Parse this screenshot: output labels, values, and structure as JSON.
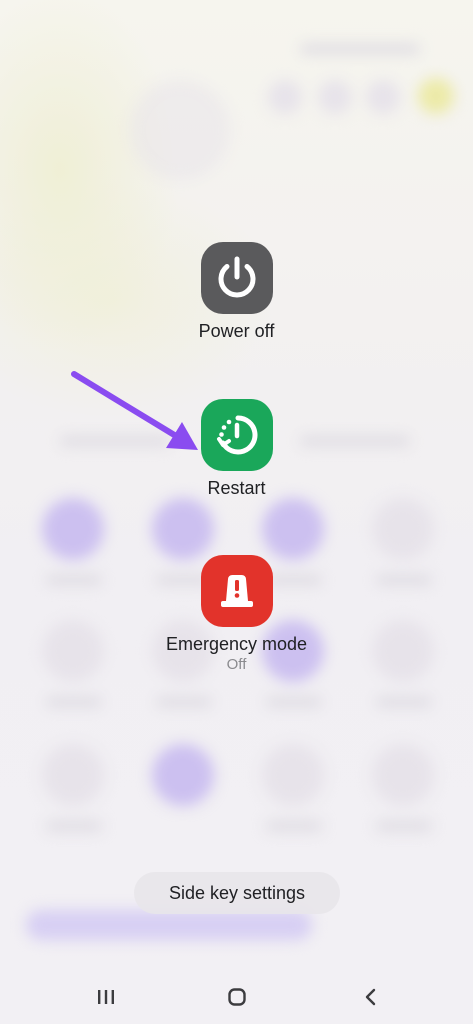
{
  "power_menu": {
    "power_off": {
      "label": "Power off",
      "icon": "power-icon",
      "color": "#5a5a5c"
    },
    "restart": {
      "label": "Restart",
      "icon": "restart-icon",
      "color": "#1aa75a"
    },
    "emergency": {
      "label": "Emergency mode",
      "status": "Off",
      "icon": "emergency-light-icon",
      "color": "#e2332b"
    }
  },
  "side_key_settings": {
    "label": "Side key settings"
  },
  "nav_bar": {
    "recents": "recent-apps-icon",
    "home": "home-icon",
    "back": "back-icon"
  },
  "annotation": {
    "arrow_color": "#8a4cf0"
  }
}
